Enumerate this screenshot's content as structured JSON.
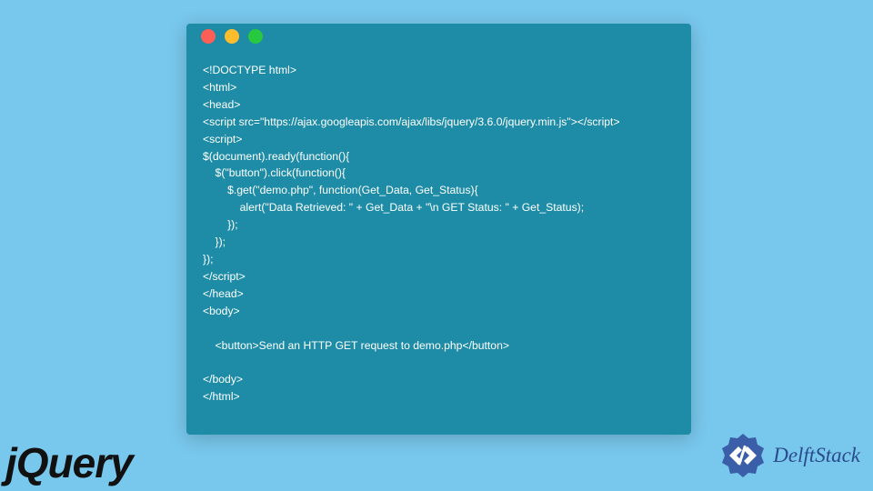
{
  "window": {
    "dots": {
      "red": "#ff5f56",
      "yellow": "#ffbd2e",
      "green": "#27c93f"
    }
  },
  "code": {
    "lines": [
      "<!DOCTYPE html>",
      "<html>",
      "<head>",
      "<script src=\"https://ajax.googleapis.com/ajax/libs/jquery/3.6.0/jquery.min.js\"></script>",
      "<script>",
      "$(document).ready(function(){",
      "    $(\"button\").click(function(){",
      "        $.get(\"demo.php\", function(Get_Data, Get_Status){",
      "            alert(\"Data Retrieved: \" + Get_Data + \"\\n GET Status: \" + Get_Status);",
      "        });",
      "    });",
      "});",
      "</script>",
      "</head>",
      "<body>",
      "",
      "    <button>Send an HTTP GET request to demo.php</button>",
      "",
      "</body>",
      "</html>"
    ]
  },
  "logos": {
    "jquery": "jQuery",
    "delft": "DelftStack"
  },
  "colors": {
    "page_bg": "#78c7ec",
    "window_bg": "#1e8ca6",
    "code_fg": "#ffffff",
    "delft_blue": "#2a4b8d"
  }
}
